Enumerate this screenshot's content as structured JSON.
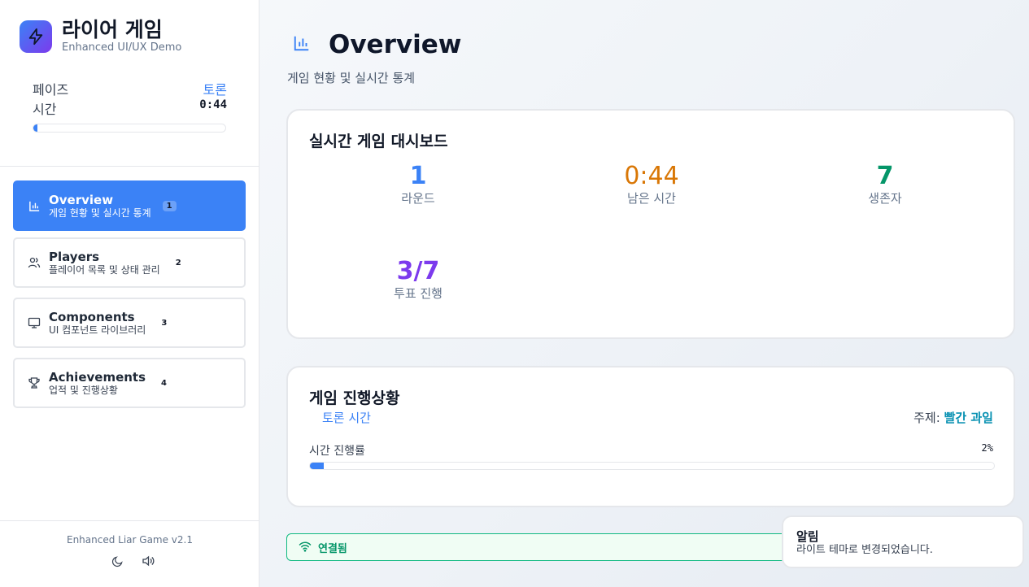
{
  "brand": {
    "title": "라이어 게임",
    "subtitle": "Enhanced UI/UX Demo"
  },
  "status": {
    "phase_label": "페이즈",
    "phase_value": "토론",
    "time_label": "시간",
    "time_value": "0:44",
    "progress": 0.02
  },
  "nav": [
    {
      "title": "Overview",
      "desc": "게임 현황 및 실시간 통계",
      "badge": "1",
      "icon": "bar-chart-icon"
    },
    {
      "title": "Players",
      "desc": "플레이어 목록 및 상태 관리",
      "badge": "2",
      "icon": "users-icon"
    },
    {
      "title": "Components",
      "desc": "UI 컴포넌트 라이브러리",
      "badge": "3",
      "icon": "monitor-icon"
    },
    {
      "title": "Achievements",
      "desc": "업적 및 진행상황",
      "badge": "4",
      "icon": "trophy-icon"
    }
  ],
  "footer": {
    "version": "Enhanced Liar Game v2.1"
  },
  "header": {
    "title": "Overview",
    "subtitle": "게임 현황 및 실시간 통계"
  },
  "dashboard": {
    "title": "실시간 게임 대시보드",
    "stats": [
      {
        "value": "1",
        "label": "라운드",
        "color": "#3b82f6"
      },
      {
        "value": "0:44",
        "label": "남은 시간",
        "color": "#d97706"
      },
      {
        "value": "7",
        "label": "생존자",
        "color": "#059669"
      },
      {
        "value": "3/7",
        "label": "투표 진행",
        "color": "#7c3aed"
      }
    ]
  },
  "progress_card": {
    "title": "게임 진행상황",
    "phase": "토론 시간",
    "topic_label": "주제:",
    "topic_value": "빨간 과일",
    "time_progress_label": "시간 진행률",
    "time_progress_pct": "2%",
    "time_progress": 0.02
  },
  "connection": {
    "label": "연결됨"
  },
  "toast": {
    "title": "알림",
    "message": "라이트 테마로 변경되었습니다."
  },
  "colors": {
    "accent": "#3b82f6",
    "success": "#10b981"
  }
}
